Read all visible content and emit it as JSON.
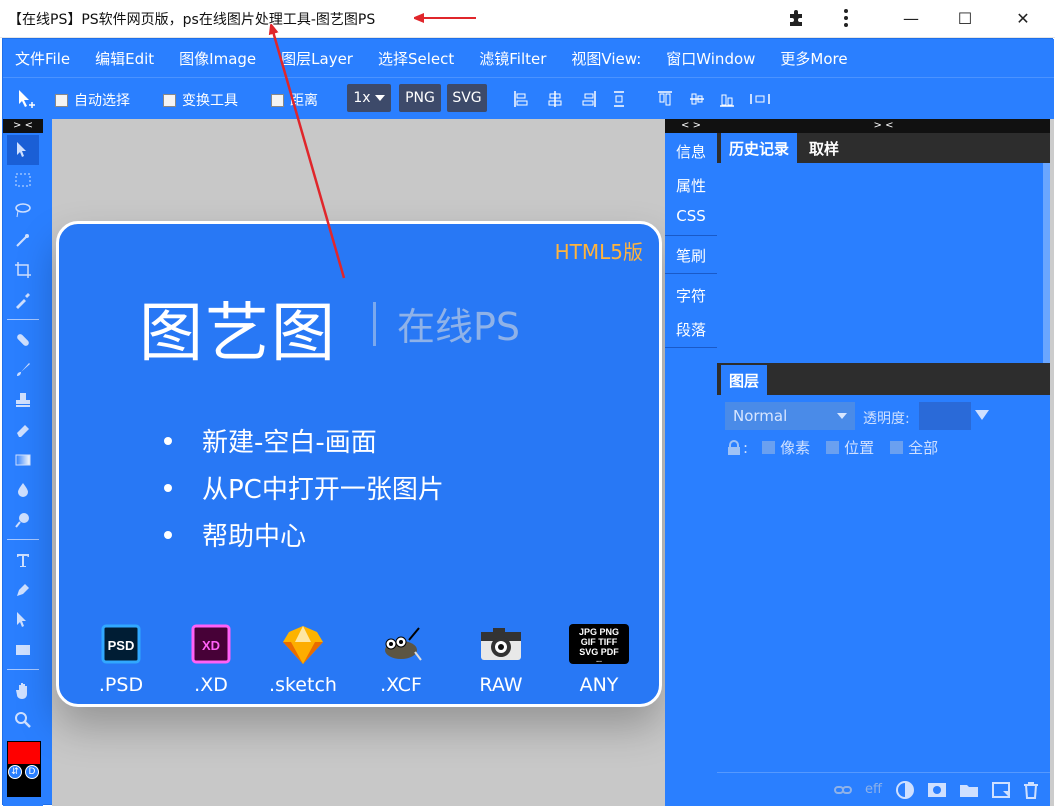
{
  "window": {
    "title": "【在线PS】PS软件网页版，ps在线图片处理工具-图艺图PS",
    "buttons": {
      "minimize": "—",
      "maximize": "☐",
      "close": "✕"
    }
  },
  "menu": [
    "文件File",
    "编辑Edit",
    "图像Image",
    "图层Layer",
    "选择Select",
    "滤镜Filter",
    "视图View:",
    "窗口Window",
    "更多More"
  ],
  "toolbar": {
    "auto_select": "自动选择",
    "transform": "变换工具",
    "distance": "距离",
    "zoom": "1x",
    "png": "PNG",
    "svg": "SVG"
  },
  "panel_headers": {
    "left": "> <",
    "middle": "< >",
    "right": "> <"
  },
  "canvas": {
    "badge": "HTML5版",
    "brand_title": "图艺图",
    "brand_subtitle": "在线PS",
    "bullets": [
      "新建-空白-画面",
      "从PC中打开一张图片",
      "帮助中心"
    ],
    "formats": [
      {
        "label": ".PSD",
        "icon": "psd-icon",
        "badge": "PSD"
      },
      {
        "label": ".XD",
        "icon": "xd-icon",
        "badge": "XD"
      },
      {
        "label": ".sketch",
        "icon": "sketch-icon"
      },
      {
        "label": ".XCF",
        "icon": "gimp-icon"
      },
      {
        "label": "RAW",
        "icon": "camera-icon"
      },
      {
        "label": "ANY",
        "icon": "any-format-icon",
        "badge_lines": [
          "JPG PNG",
          "GIF  TIFF",
          "SVG  PDF",
          "..."
        ]
      }
    ]
  },
  "mid_panel": [
    "信息",
    "属性",
    "CSS",
    "笔刷",
    "字符",
    "段落"
  ],
  "right_panel": {
    "tabs_top": [
      "历史记录",
      "取样"
    ],
    "tabs_layers": [
      "图层"
    ],
    "blend_mode": "Normal",
    "opacity_label": "透明度:",
    "lock_label": ":",
    "lock_options": [
      "像素",
      "位置",
      "全部"
    ],
    "footer_eff": "eff"
  },
  "colors": {
    "app_blue": "#2a7fff",
    "foreground": "#ff0000",
    "background": "#000000",
    "badge_orange": "#ffb43d",
    "arrow_red": "#e0262b"
  },
  "color_swatch": {
    "swap": "⇵",
    "default": "D"
  }
}
